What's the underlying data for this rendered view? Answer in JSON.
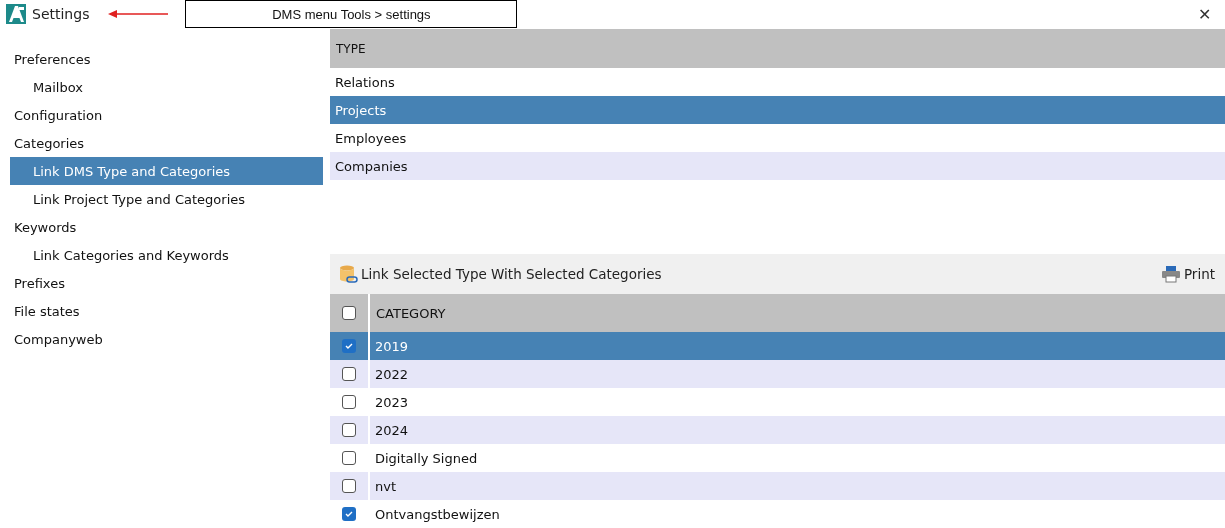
{
  "window": {
    "title": "Settings",
    "close": "✕"
  },
  "annotation": {
    "text": "DMS menu Tools > settings"
  },
  "sidebar": {
    "items": [
      {
        "label": "Preferences",
        "selected": false,
        "children": [
          {
            "label": "Mailbox",
            "selected": false
          }
        ]
      },
      {
        "label": "Configuration",
        "selected": false
      },
      {
        "label": "Categories",
        "selected": false,
        "children": [
          {
            "label": "Link DMS Type and Categories",
            "selected": true
          },
          {
            "label": "Link Project Type and Categories",
            "selected": false
          }
        ]
      },
      {
        "label": "Keywords",
        "selected": false,
        "children": [
          {
            "label": "Link Categories and Keywords",
            "selected": false
          }
        ]
      },
      {
        "label": "Prefixes",
        "selected": false
      },
      {
        "label": "File states",
        "selected": false
      },
      {
        "label": "Companyweb",
        "selected": false
      }
    ]
  },
  "type_table": {
    "column": "TYPE",
    "rows": [
      {
        "label": "Relations",
        "selected": false
      },
      {
        "label": "Projects",
        "selected": true
      },
      {
        "label": "Employees",
        "selected": false
      },
      {
        "label": "Companies",
        "selected": false
      }
    ]
  },
  "toolbar": {
    "link_button": "Link Selected Type With Selected Categories",
    "print_button": "Print"
  },
  "category_table": {
    "column": "CATEGORY",
    "all_checked": false,
    "rows": [
      {
        "label": "2019",
        "checked": true,
        "selected": true
      },
      {
        "label": "2022",
        "checked": false,
        "selected": false
      },
      {
        "label": "2023",
        "checked": false,
        "selected": false
      },
      {
        "label": "2024",
        "checked": false,
        "selected": false
      },
      {
        "label": "Digitally Signed",
        "checked": false,
        "selected": false
      },
      {
        "label": "nvt",
        "checked": false,
        "selected": false
      },
      {
        "label": "Ontvangstbewijzen",
        "checked": true,
        "selected": false
      }
    ]
  }
}
